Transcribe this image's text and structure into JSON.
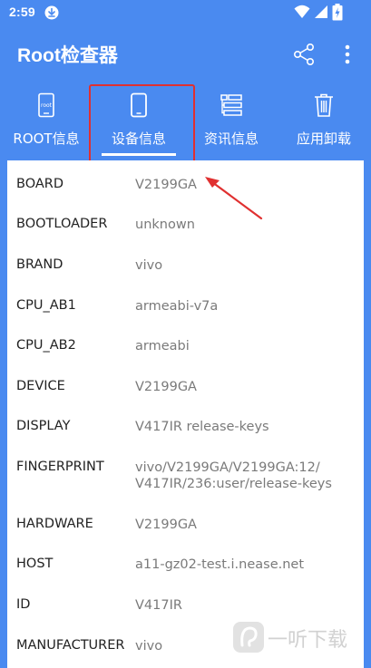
{
  "status_bar": {
    "time": "2:59",
    "icons": [
      "download-icon",
      "wifi-icon",
      "signal-icon",
      "battery-charging-icon"
    ]
  },
  "app_bar": {
    "title": "Root检查器",
    "actions": [
      "share-icon",
      "more-icon"
    ]
  },
  "tabs": [
    {
      "label": "ROOT信息",
      "icon": "root-phone-icon",
      "selected": false
    },
    {
      "label": "设备信息",
      "icon": "phone-icon",
      "selected": true
    },
    {
      "label": "资讯信息",
      "icon": "list-icon",
      "selected": false
    },
    {
      "label": "应用卸载",
      "icon": "trash-icon",
      "selected": false
    }
  ],
  "device_info": [
    {
      "key": "BOARD",
      "value": "V2199GA"
    },
    {
      "key": "BOOTLOADER",
      "value": "unknown"
    },
    {
      "key": "BRAND",
      "value": "vivo"
    },
    {
      "key": "CPU_AB1",
      "value": "armeabi-v7a"
    },
    {
      "key": "CPU_AB2",
      "value": "armeabi"
    },
    {
      "key": "DEVICE",
      "value": "V2199GA"
    },
    {
      "key": "DISPLAY",
      "value": "V417IR release-keys"
    },
    {
      "key": "FINGERPRINT",
      "value": "vivo/V2199GA/V2199GA:12/\nV417IR/236:user/release-keys"
    },
    {
      "key": "HARDWARE",
      "value": "V2199GA"
    },
    {
      "key": "HOST",
      "value": "a11-gz02-test.i.nease.net"
    },
    {
      "key": "ID",
      "value": "V417IR"
    },
    {
      "key": "MANUFACTURER",
      "value": "vivo"
    }
  ],
  "watermark": "一听下载",
  "colors": {
    "primary": "#4a8af0",
    "highlight": "#e03030",
    "key_text": "#222222",
    "value_text": "#7a7a7a"
  }
}
